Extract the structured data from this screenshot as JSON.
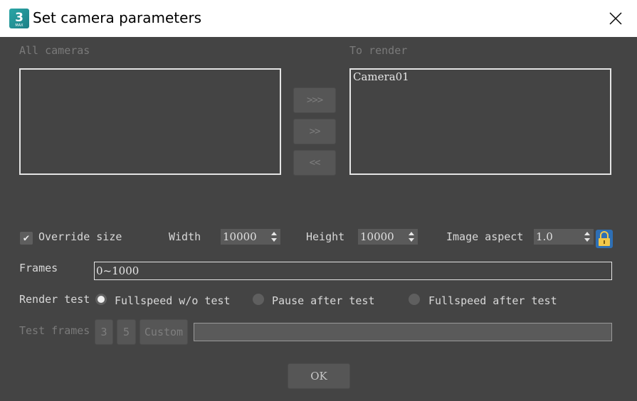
{
  "window": {
    "title": "Set camera parameters",
    "app_icon_text": "3",
    "app_icon_subtext": "MAX"
  },
  "lists": {
    "all_cameras_label": "All cameras",
    "to_render_label": "To render",
    "all_cameras_items": [],
    "to_render_items": [
      "Camera01"
    ]
  },
  "move_buttons": {
    "add_all": ">>>",
    "add": ">>",
    "remove": "<<"
  },
  "size": {
    "override_label": "Override size",
    "override_checked": true,
    "width_label": "Width",
    "width_value": "10000",
    "height_label": "Height",
    "height_value": "10000",
    "aspect_label": "Image aspect",
    "aspect_value": "1.0"
  },
  "frames": {
    "label": "Frames",
    "value": "0~1000"
  },
  "render_test": {
    "label": "Render test",
    "options": [
      "Fullspeed w/o test",
      "Pause after test",
      "Fullspeed after test"
    ],
    "selected": "Fullspeed w/o test"
  },
  "test_frames": {
    "label": "Test frames",
    "buttons": [
      "3",
      "5",
      "Custom"
    ],
    "value": ""
  },
  "footer": {
    "ok_label": "OK"
  }
}
